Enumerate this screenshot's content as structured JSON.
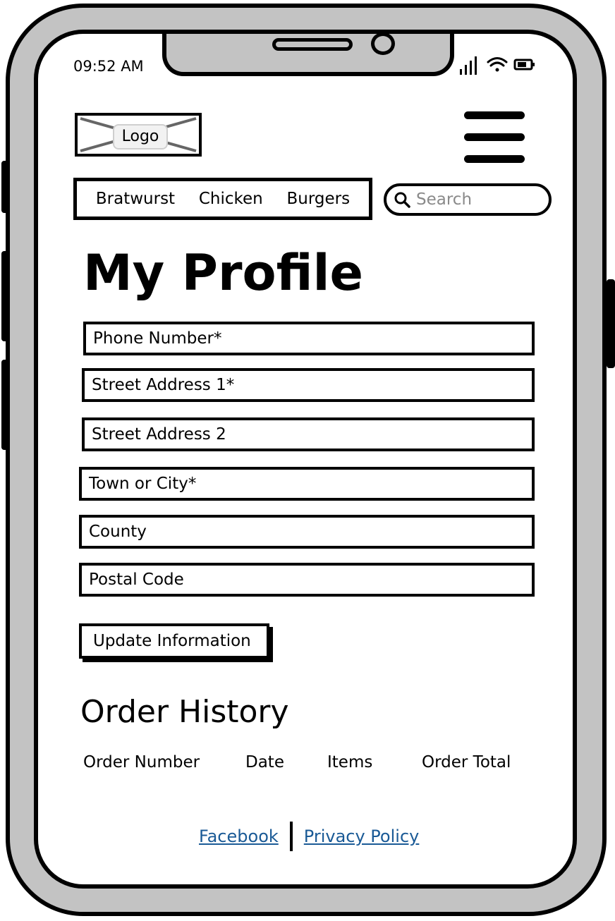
{
  "status_bar": {
    "time": "09:52 AM",
    "icons": [
      "signal-icon",
      "wifi-icon",
      "battery-icon"
    ]
  },
  "header": {
    "logo_label": "Logo",
    "menu_icon": "hamburger-menu-icon"
  },
  "nav": {
    "items": [
      "Bratwurst",
      "Chicken",
      "Burgers"
    ]
  },
  "search": {
    "placeholder": "Search",
    "icon": "search-icon"
  },
  "page_title": "My Profile",
  "form": {
    "fields": [
      "Phone Number*",
      "Street Address 1*",
      "Street Address 2",
      "Town or City*",
      "County",
      "Postal Code"
    ],
    "submit_label": "Update Information"
  },
  "order_history": {
    "title": "Order History",
    "columns": [
      "Order Number",
      "Date",
      "Items",
      "Order Total"
    ]
  },
  "footer": {
    "links": [
      "Facebook",
      "Privacy Policy"
    ]
  },
  "colors": {
    "frame": "#c3c3c3",
    "link": "#1a5a96",
    "placeholder": "#8a8a8a"
  }
}
